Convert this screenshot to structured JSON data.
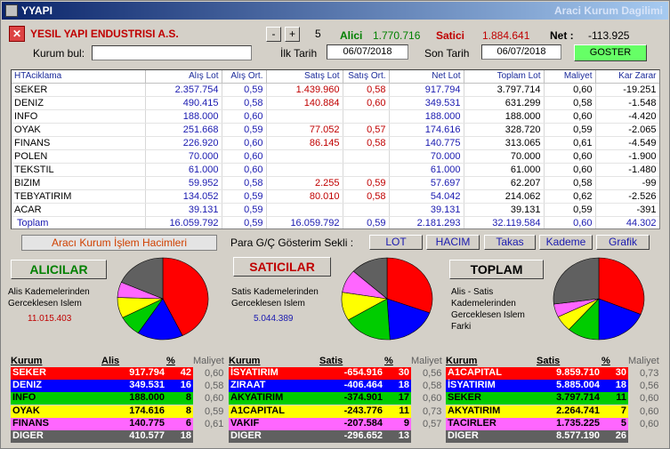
{
  "window": {
    "title": "YYAPI",
    "title_right": "Araci Kurum Dagilimi"
  },
  "header": {
    "company": "YESIL YAPI ENDUSTRISI A.S.",
    "minus": "-",
    "plus": "+",
    "count": "5",
    "alici_label": "Alici",
    "alici_value": "1.770.716",
    "satici_label": "Satici",
    "satici_value": "1.884.641",
    "net_label": "Net :",
    "net_value": "-113.925",
    "kurum_label": "Kurum bul:",
    "kurum_value": "",
    "ilk_tarih_label": "İlk Tarih",
    "ilk_tarih": "06/07/2018",
    "son_tarih_label": "Son Tarih",
    "son_tarih": "06/07/2018",
    "goster": "GOSTER"
  },
  "table": {
    "columns": [
      "HTAciklama",
      "Alış Lot",
      "Alış Ort.",
      "Satış Lot",
      "Satış Ort.",
      "Net Lot",
      "Toplam Lot",
      "Maliyet",
      "Kar Zarar"
    ],
    "rows": [
      [
        "SEKER",
        "2.357.754",
        "0,59",
        "1.439.960",
        "0,58",
        "917.794",
        "3.797.714",
        "0,60",
        "-19.251"
      ],
      [
        "DENIZ",
        "490.415",
        "0,58",
        "140.884",
        "0,60",
        "349.531",
        "631.299",
        "0,58",
        "-1.548"
      ],
      [
        "INFO",
        "188.000",
        "0,60",
        "",
        "",
        "188.000",
        "188.000",
        "0,60",
        "-4.420"
      ],
      [
        "OYAK",
        "251.668",
        "0,59",
        "77.052",
        "0,57",
        "174.616",
        "328.720",
        "0,59",
        "-2.065"
      ],
      [
        "FINANS",
        "226.920",
        "0,60",
        "86.145",
        "0,58",
        "140.775",
        "313.065",
        "0,61",
        "-4.549"
      ],
      [
        "POLEN",
        "70.000",
        "0,60",
        "",
        "",
        "70.000",
        "70.000",
        "0,60",
        "-1.900"
      ],
      [
        "TEKSTIL",
        "61.000",
        "0,60",
        "",
        "",
        "61.000",
        "61.000",
        "0,60",
        "-1.480"
      ],
      [
        "BIZIM",
        "59.952",
        "0,58",
        "2.255",
        "0,59",
        "57.697",
        "62.207",
        "0,58",
        "-99"
      ],
      [
        "TEBYATIRIM",
        "134.052",
        "0,59",
        "80.010",
        "0,58",
        "54.042",
        "214.062",
        "0,62",
        "-2.526"
      ],
      [
        "ACAR",
        "39.131",
        "0,59",
        "",
        "",
        "39.131",
        "39.131",
        "0,59",
        "-391"
      ]
    ],
    "total": [
      "Toplam",
      "16.059.792",
      "0,59",
      "16.059.792",
      "0,59",
      "2.181.293",
      "32.119.584",
      "0,60",
      "44.302"
    ]
  },
  "mid": {
    "volume_caption": "Aracı Kurum İşlem Hacimleri",
    "para_label": "Para G/Ç Gösterim Sekli :",
    "tabs": [
      "LOT",
      "HACIM",
      "Takas",
      "Kademe",
      "Grafik"
    ]
  },
  "summary": {
    "alicilar": {
      "title": "ALICILAR",
      "desc": [
        "Alis Kademelerinden",
        "Gerceklesen Islem"
      ],
      "value": "11.015.403"
    },
    "saticilar": {
      "title": "SATICILAR",
      "desc": [
        "Satis Kademelerinden",
        "Gerceklesen Islem"
      ],
      "value": "5.044.389"
    },
    "toplam": {
      "title": "TOPLAM",
      "desc": [
        "Alis - Satis",
        "Kademelerinden",
        "Gerceklesen Islem",
        "Farki"
      ]
    }
  },
  "pies": [
    {
      "name": "alis-pie",
      "slices": [
        {
          "v": 42,
          "c": "#ff0000"
        },
        {
          "v": 16,
          "c": "#0000ff"
        },
        {
          "v": 8,
          "c": "#00cc00"
        },
        {
          "v": 8,
          "c": "#ffff00"
        },
        {
          "v": 6,
          "c": "#ff66ff"
        },
        {
          "v": 18,
          "c": "#606060"
        }
      ]
    },
    {
      "name": "satis-pie",
      "slices": [
        {
          "v": 30,
          "c": "#ff0000"
        },
        {
          "v": 18,
          "c": "#0000ff"
        },
        {
          "v": 17,
          "c": "#00cc00"
        },
        {
          "v": 11,
          "c": "#ffff00"
        },
        {
          "v": 9,
          "c": "#ff66ff"
        },
        {
          "v": 13,
          "c": "#606060"
        }
      ]
    },
    {
      "name": "toplam-pie",
      "slices": [
        {
          "v": 30,
          "c": "#ff0000"
        },
        {
          "v": 18,
          "c": "#0000ff"
        },
        {
          "v": 11,
          "c": "#00cc00"
        },
        {
          "v": 6,
          "c": "#ffff00"
        },
        {
          "v": 5,
          "c": "#ff66ff"
        },
        {
          "v": 26,
          "c": "#606060"
        }
      ]
    }
  ],
  "panels": [
    {
      "headers": [
        "Kurum",
        "Alis",
        "%",
        "Maliyet"
      ],
      "rows": [
        {
          "k": "SEKER",
          "v": "917.794",
          "p": "42",
          "m": "0,60",
          "bg": "#ff0000",
          "fg": "#ffffff"
        },
        {
          "k": "DENIZ",
          "v": "349.531",
          "p": "16",
          "m": "0,58",
          "bg": "#0000ff",
          "fg": "#ffffff"
        },
        {
          "k": "INFO",
          "v": "188.000",
          "p": "8",
          "m": "0,60",
          "bg": "#00cc00",
          "fg": "#000000"
        },
        {
          "k": "OYAK",
          "v": "174.616",
          "p": "8",
          "m": "0,59",
          "bg": "#ffff00",
          "fg": "#000000"
        },
        {
          "k": "FINANS",
          "v": "140.775",
          "p": "6",
          "m": "0,61",
          "bg": "#ff66ff",
          "fg": "#000000"
        },
        {
          "k": "DIGER",
          "v": "410.577",
          "p": "18",
          "m": "",
          "bg": "#606060",
          "fg": "#ffffff"
        }
      ]
    },
    {
      "headers": [
        "Kurum",
        "Satis",
        "%",
        "Maliyet"
      ],
      "rows": [
        {
          "k": "İSYATIRIM",
          "v": "-654.916",
          "p": "30",
          "m": "0,56",
          "bg": "#ff0000",
          "fg": "#ffffff"
        },
        {
          "k": "ZIRAAT",
          "v": "-406.464",
          "p": "18",
          "m": "0,58",
          "bg": "#0000ff",
          "fg": "#ffffff"
        },
        {
          "k": "AKYATIRIM",
          "v": "-374.901",
          "p": "17",
          "m": "0,60",
          "bg": "#00cc00",
          "fg": "#000000"
        },
        {
          "k": "A1CAPITAL",
          "v": "-243.776",
          "p": "11",
          "m": "0,73",
          "bg": "#ffff00",
          "fg": "#000000"
        },
        {
          "k": "VAKIF",
          "v": "-207.584",
          "p": "9",
          "m": "0,57",
          "bg": "#ff66ff",
          "fg": "#000000"
        },
        {
          "k": "DIGER",
          "v": "-296.652",
          "p": "13",
          "m": "",
          "bg": "#606060",
          "fg": "#ffffff"
        }
      ]
    },
    {
      "headers": [
        "Kurum",
        "Satis",
        "%",
        "Maliyet"
      ],
      "rows": [
        {
          "k": "A1CAPITAL",
          "v": "9.859.710",
          "p": "30",
          "m": "0,73",
          "bg": "#ff0000",
          "fg": "#ffffff"
        },
        {
          "k": "İSYATIRIM",
          "v": "5.885.004",
          "p": "18",
          "m": "0,56",
          "bg": "#0000ff",
          "fg": "#ffffff"
        },
        {
          "k": "SEKER",
          "v": "3.797.714",
          "p": "11",
          "m": "0,60",
          "bg": "#00cc00",
          "fg": "#000000"
        },
        {
          "k": "AKYATIRIM",
          "v": "2.264.741",
          "p": "7",
          "m": "0,60",
          "bg": "#ffff00",
          "fg": "#000000"
        },
        {
          "k": "TACIRLER",
          "v": "1.735.225",
          "p": "5",
          "m": "0,60",
          "bg": "#ff66ff",
          "fg": "#000000"
        },
        {
          "k": "DIGER",
          "v": "8.577.190",
          "p": "26",
          "m": "",
          "bg": "#606060",
          "fg": "#ffffff"
        }
      ]
    }
  ]
}
